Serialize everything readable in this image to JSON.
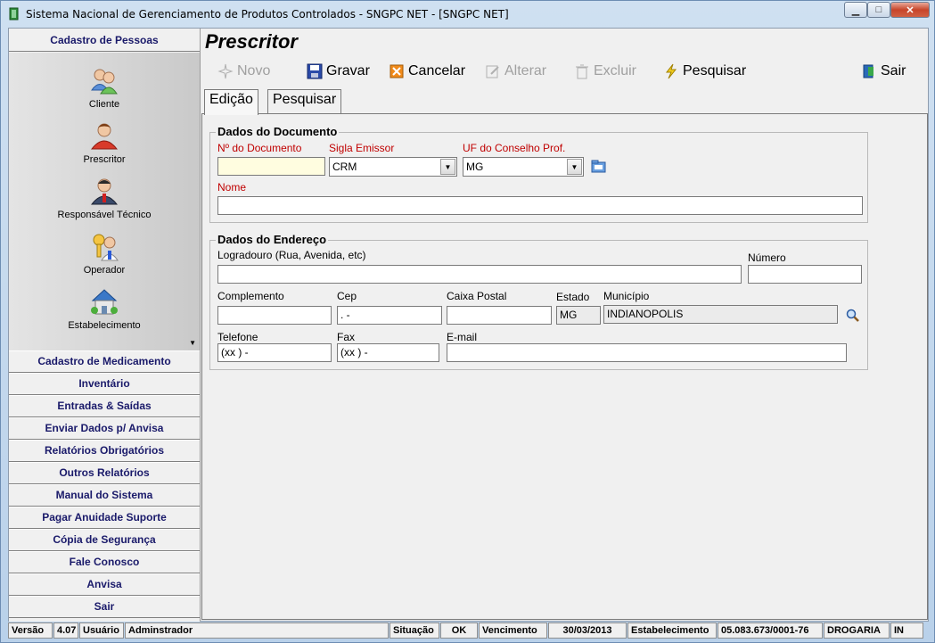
{
  "window": {
    "title": "Sistema Nacional de Gerenciamento de Produtos Controlados - SNGPC NET - [SNGPC NET]",
    "minimize": "▁",
    "maximize": "□",
    "close": "✕"
  },
  "sidebar": {
    "header": "Cadastro de Pessoas",
    "items": [
      {
        "label": "Cliente",
        "icon": "people-icon"
      },
      {
        "label": "Prescritor",
        "icon": "doctor-icon"
      },
      {
        "label": "Responsável Técnico",
        "icon": "technician-icon"
      },
      {
        "label": "Operador",
        "icon": "operator-icon"
      },
      {
        "label": "Estabelecimento",
        "icon": "building-icon"
      }
    ],
    "scroll_arrow": "▼",
    "buttons": [
      "Cadastro de Medicamento",
      "Inventário",
      "Entradas & Saídas",
      "Enviar Dados p/ Anvisa",
      "Relatórios Obrigatórios",
      "Outros Relatórios",
      "Manual do Sistema",
      "Pagar Anuidade Suporte",
      "Cópia de Segurança",
      "Fale Conosco",
      "Anvisa",
      "Sair"
    ]
  },
  "page": {
    "title": "Prescritor"
  },
  "toolbar": {
    "novo": "Novo",
    "gravar": "Gravar",
    "cancelar": "Cancelar",
    "alterar": "Alterar",
    "excluir": "Excluir",
    "pesquisar": "Pesquisar",
    "sair": "Sair"
  },
  "tabs": {
    "edicao": "Edição",
    "pesquisar": "Pesquisar"
  },
  "documento": {
    "legend": "Dados do Documento",
    "num_label": "Nº do Documento",
    "num_value": "",
    "sigla_label": "Sigla Emissor",
    "sigla_value": "CRM",
    "uf_label": "UF do Conselho Prof.",
    "uf_value": "MG",
    "nome_label": "Nome",
    "nome_value": ""
  },
  "endereco": {
    "legend": "Dados do Endereço",
    "logradouro_label": "Logradouro (Rua, Avenida, etc)",
    "logradouro_value": "",
    "numero_label": "Número",
    "numero_value": "",
    "complemento_label": "Complemento",
    "complemento_value": "",
    "cep_label": "Cep",
    "cep_value": " .  -",
    "caixa_label": "Caixa Postal",
    "caixa_value": "",
    "estado_label": "Estado",
    "estado_value": "MG",
    "municipio_label": "Município",
    "municipio_value": "INDIANOPOLIS",
    "telefone_label": "Telefone",
    "telefone_value": "(xx )   -",
    "fax_label": "Fax",
    "fax_value": "(xx )   -",
    "email_label": "E-mail",
    "email_value": ""
  },
  "status": {
    "versao_label": "Versão",
    "versao_value": "4.07",
    "usuario_label": "Usuário",
    "usuario_value": "Adminstrador",
    "situacao_label": "Situação",
    "situacao_value": "OK",
    "vencimento_label": "Vencimento",
    "vencimento_value": "30/03/2013",
    "estab_label": "Estabelecimento",
    "estab_value": "05.083.673/0001-76",
    "tipo_value": "DROGARIA",
    "extra_value": "IN"
  }
}
